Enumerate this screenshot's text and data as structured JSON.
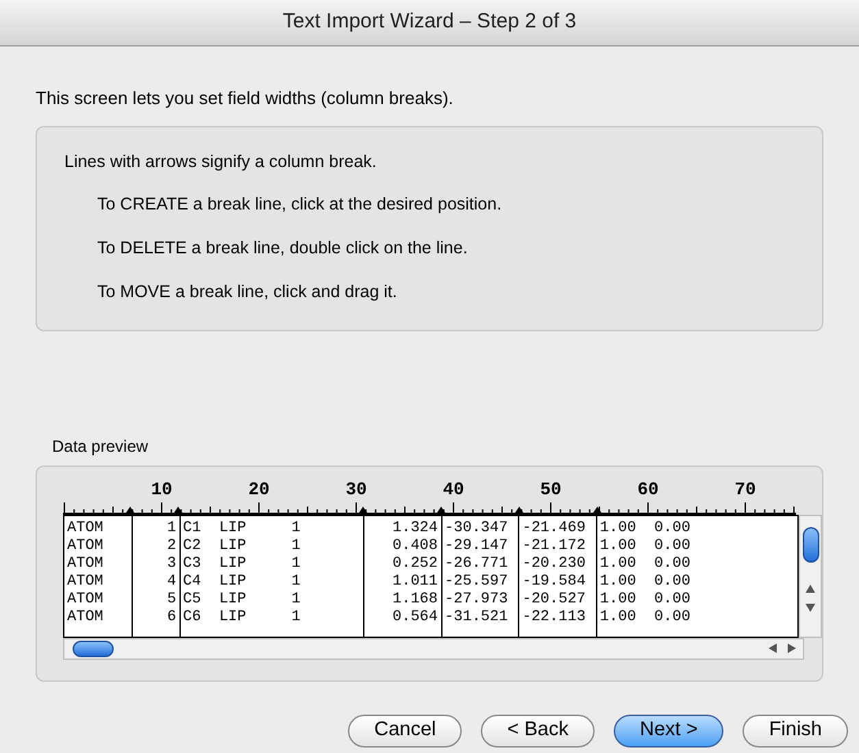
{
  "window": {
    "title": "Text Import Wizard – Step 2 of 3"
  },
  "intro": "This screen lets you set field widths (column breaks).",
  "instructions": {
    "heading": "Lines with arrows signify a column break.",
    "items": [
      "To CREATE a break line, click at the desired position.",
      "To DELETE a break line, double click on the line.",
      "To MOVE a break line, click and drag it."
    ]
  },
  "preview": {
    "label": "Data preview",
    "ruler": [
      "10",
      "20",
      "30",
      "40",
      "50",
      "60",
      "70"
    ],
    "rows": [
      [
        "ATOM",
        "1",
        "C1  LIP     1",
        "1.324",
        "-30.347",
        "-21.469",
        "1.00  0.00"
      ],
      [
        "ATOM",
        "2",
        "C2  LIP     1",
        "0.408",
        "-29.147",
        "-21.172",
        "1.00  0.00"
      ],
      [
        "ATOM",
        "3",
        "C3  LIP     1",
        "0.252",
        "-26.771",
        "-20.230",
        "1.00  0.00"
      ],
      [
        "ATOM",
        "4",
        "C4  LIP     1",
        "1.011",
        "-25.597",
        "-19.584",
        "1.00  0.00"
      ],
      [
        "ATOM",
        "5",
        "C5  LIP     1",
        "1.168",
        "-27.973",
        "-20.527",
        "1.00  0.00"
      ],
      [
        "ATOM",
        "6",
        "C6  LIP     1",
        "0.564",
        "-31.521",
        "-22.113",
        "1.00  0.00"
      ]
    ]
  },
  "buttons": [
    {
      "label": "Cancel",
      "default": false
    },
    {
      "label": "< Back",
      "default": false
    },
    {
      "label": "Next >",
      "default": true
    },
    {
      "label": "Finish",
      "default": false
    }
  ]
}
